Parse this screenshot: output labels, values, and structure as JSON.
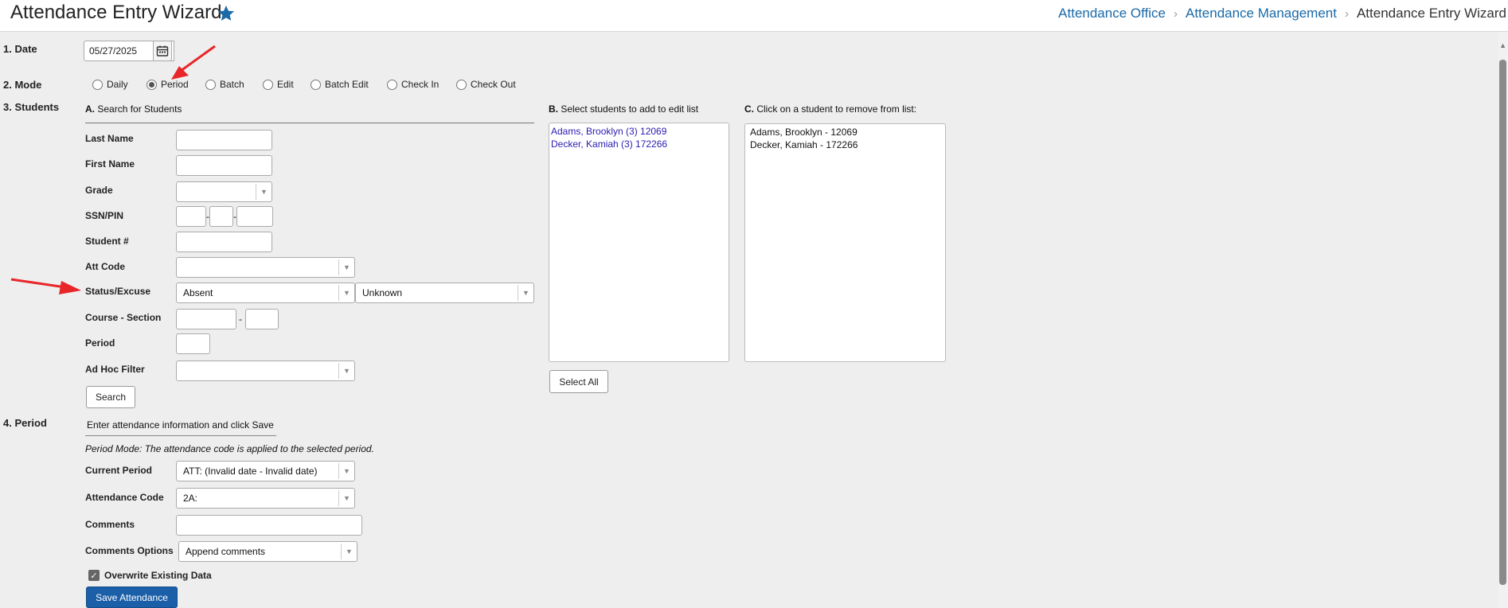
{
  "header": {
    "title": "Attendance Entry Wizard",
    "breadcrumb": [
      "Attendance Office",
      "Attendance Management",
      "Attendance Entry Wizard"
    ]
  },
  "sections": {
    "date": "1. Date",
    "mode": "2. Mode",
    "students": "3. Students",
    "period": "4. Period"
  },
  "date_value": "05/27/2025",
  "modes": [
    {
      "label": "Daily",
      "selected": false
    },
    {
      "label": "Period",
      "selected": true
    },
    {
      "label": "Batch",
      "selected": false
    },
    {
      "label": "Edit",
      "selected": false
    },
    {
      "label": "Batch Edit",
      "selected": false
    },
    {
      "label": "Check In",
      "selected": false
    },
    {
      "label": "Check Out",
      "selected": false
    }
  ],
  "search": {
    "heading_letter": "A.",
    "heading": "Search for Students",
    "last_name": "Last Name",
    "first_name": "First Name",
    "grade": "Grade",
    "ssn_pin": "SSN/PIN",
    "ssn_dash": "-",
    "student_num": "Student #",
    "att_code": "Att Code",
    "status_excuse": "Status/Excuse",
    "status_value": "Absent",
    "excuse_value": "Unknown",
    "course_section": "Course - Section",
    "course_dash": "-",
    "period": "Period",
    "adhoc": "Ad Hoc Filter",
    "search_button": "Search"
  },
  "list_b": {
    "letter": "B.",
    "heading": "Select students to add to edit list",
    "items": [
      "Adams, Brooklyn (3) 12069",
      "Decker, Kamiah (3) 172266"
    ],
    "select_all": "Select All"
  },
  "list_c": {
    "letter": "C.",
    "heading": "Click on a student to remove from list:",
    "items": [
      "Adams, Brooklyn - 12069",
      "Decker, Kamiah - 172266"
    ]
  },
  "period_section": {
    "instruction": "Enter attendance information and click Save",
    "mode_note": "Period Mode: The attendance code is applied to the selected period.",
    "current_period_label": "Current Period",
    "current_period_value": "ATT: (Invalid date - Invalid date)",
    "att_code_label": "Attendance Code",
    "att_code_value": "2A:",
    "comments_label": "Comments",
    "comments_options_label": "Comments Options",
    "comments_options_value": "Append comments",
    "overwrite_label": "Overwrite Existing Data",
    "overwrite_checked": true,
    "save_button": "Save Attendance"
  },
  "colors": {
    "accent": "#1a6aa8",
    "primary_button": "#1a5fa8",
    "annotation_arrow": "#e8262a",
    "student_link": "#2a1bb0"
  }
}
